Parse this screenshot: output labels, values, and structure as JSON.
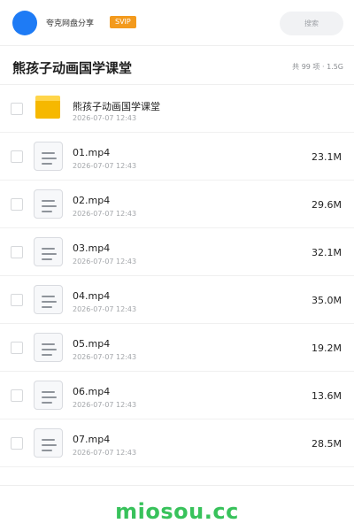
{
  "header": {
    "brand": "夸克网盘分享",
    "badge": "SVIP",
    "search_placeholder": "搜索"
  },
  "folder": {
    "title": "熊孩子动画国学课堂",
    "summary": "共 99 项 · 1.5G"
  },
  "items": [
    {
      "name": "熊孩子动画国学课堂",
      "date": "2026-07-07 12:43",
      "size": "",
      "type": "folder-icon"
    },
    {
      "name": "01.mp4",
      "date": "2026-07-07 12:43",
      "size": "23.1M",
      "type": "file-icon"
    },
    {
      "name": "02.mp4",
      "date": "2026-07-07 12:43",
      "size": "29.6M",
      "type": "file-icon"
    },
    {
      "name": "03.mp4",
      "date": "2026-07-07 12:43",
      "size": "32.1M",
      "type": "file-icon"
    },
    {
      "name": "04.mp4",
      "date": "2026-07-07 12:43",
      "size": "35.0M",
      "type": "file-icon"
    },
    {
      "name": "05.mp4",
      "date": "2026-07-07 12:43",
      "size": "19.2M",
      "type": "file-icon"
    },
    {
      "name": "06.mp4",
      "date": "2026-07-07 12:43",
      "size": "13.6M",
      "type": "file-icon"
    },
    {
      "name": "07.mp4",
      "date": "2026-07-07 12:43",
      "size": "28.5M",
      "type": "file-icon"
    }
  ],
  "watermark": "miosou.cc",
  "colors": {
    "accent_blue": "#1e7bf5",
    "svip_orange": "#f39a1d",
    "folder_yellow": "#f6b800",
    "watermark_green": "#38c25b"
  }
}
